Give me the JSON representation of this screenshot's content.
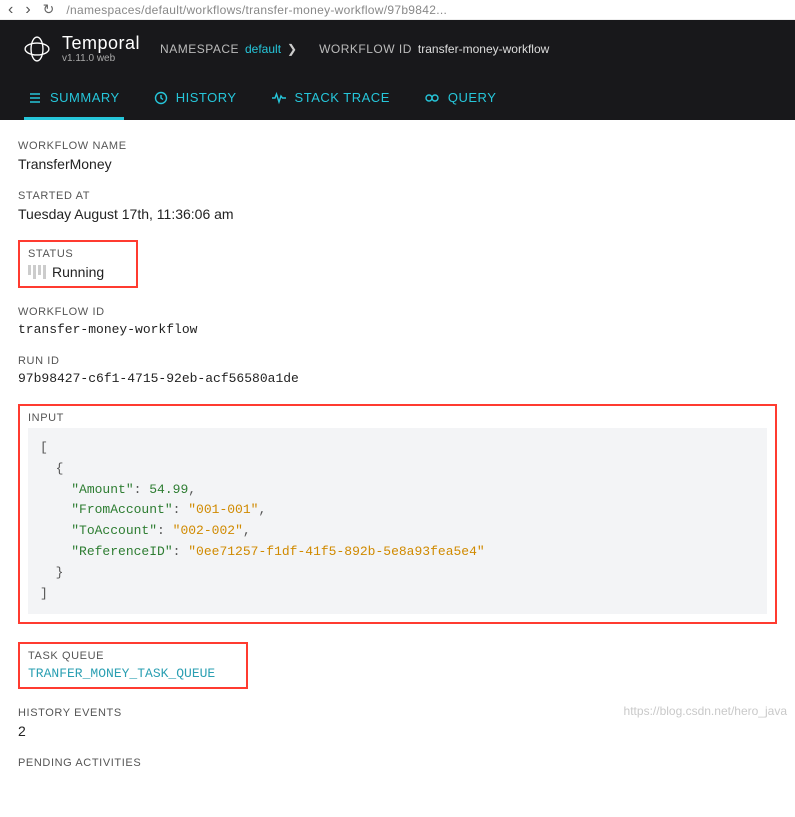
{
  "browser": {
    "url_fragment": "/namespaces/default/workflows/transfer-money-workflow/97b9842..."
  },
  "brand": {
    "name": "Temporal",
    "version": "v1.11.0 web"
  },
  "breadcrumbs": {
    "namespace_label": "NAMESPACE",
    "namespace_value": "default",
    "workflow_id_label": "WORKFLOW ID",
    "workflow_id_value": "transfer-money-workflow"
  },
  "tabs": {
    "summary": "SUMMARY",
    "history": "HISTORY",
    "stack_trace": "STACK TRACE",
    "query": "QUERY"
  },
  "labels": {
    "workflow_name": "WORKFLOW NAME",
    "started_at": "STARTED AT",
    "status": "STATUS",
    "workflow_id": "WORKFLOW ID",
    "run_id": "RUN ID",
    "input": "INPUT",
    "task_queue": "TASK QUEUE",
    "history_events": "HISTORY EVENTS",
    "pending_activities": "PENDING ACTIVITIES"
  },
  "values": {
    "workflow_name": "TransferMoney",
    "started_at": "Tuesday August 17th, 11:36:06 am",
    "status": "Running",
    "workflow_id": "transfer-money-workflow",
    "run_id": "97b98427-c6f1-4715-92eb-acf56580a1de",
    "task_queue": "TRANFER_MONEY_TASK_QUEUE",
    "history_events": "2"
  },
  "input_json": {
    "Amount": 54.99,
    "FromAccount": "001-001",
    "ToAccount": "002-002",
    "ReferenceID": "0ee71257-f1df-41f5-892b-5e8a93fea5e4"
  },
  "watermark": "https://blog.csdn.net/hero_java"
}
